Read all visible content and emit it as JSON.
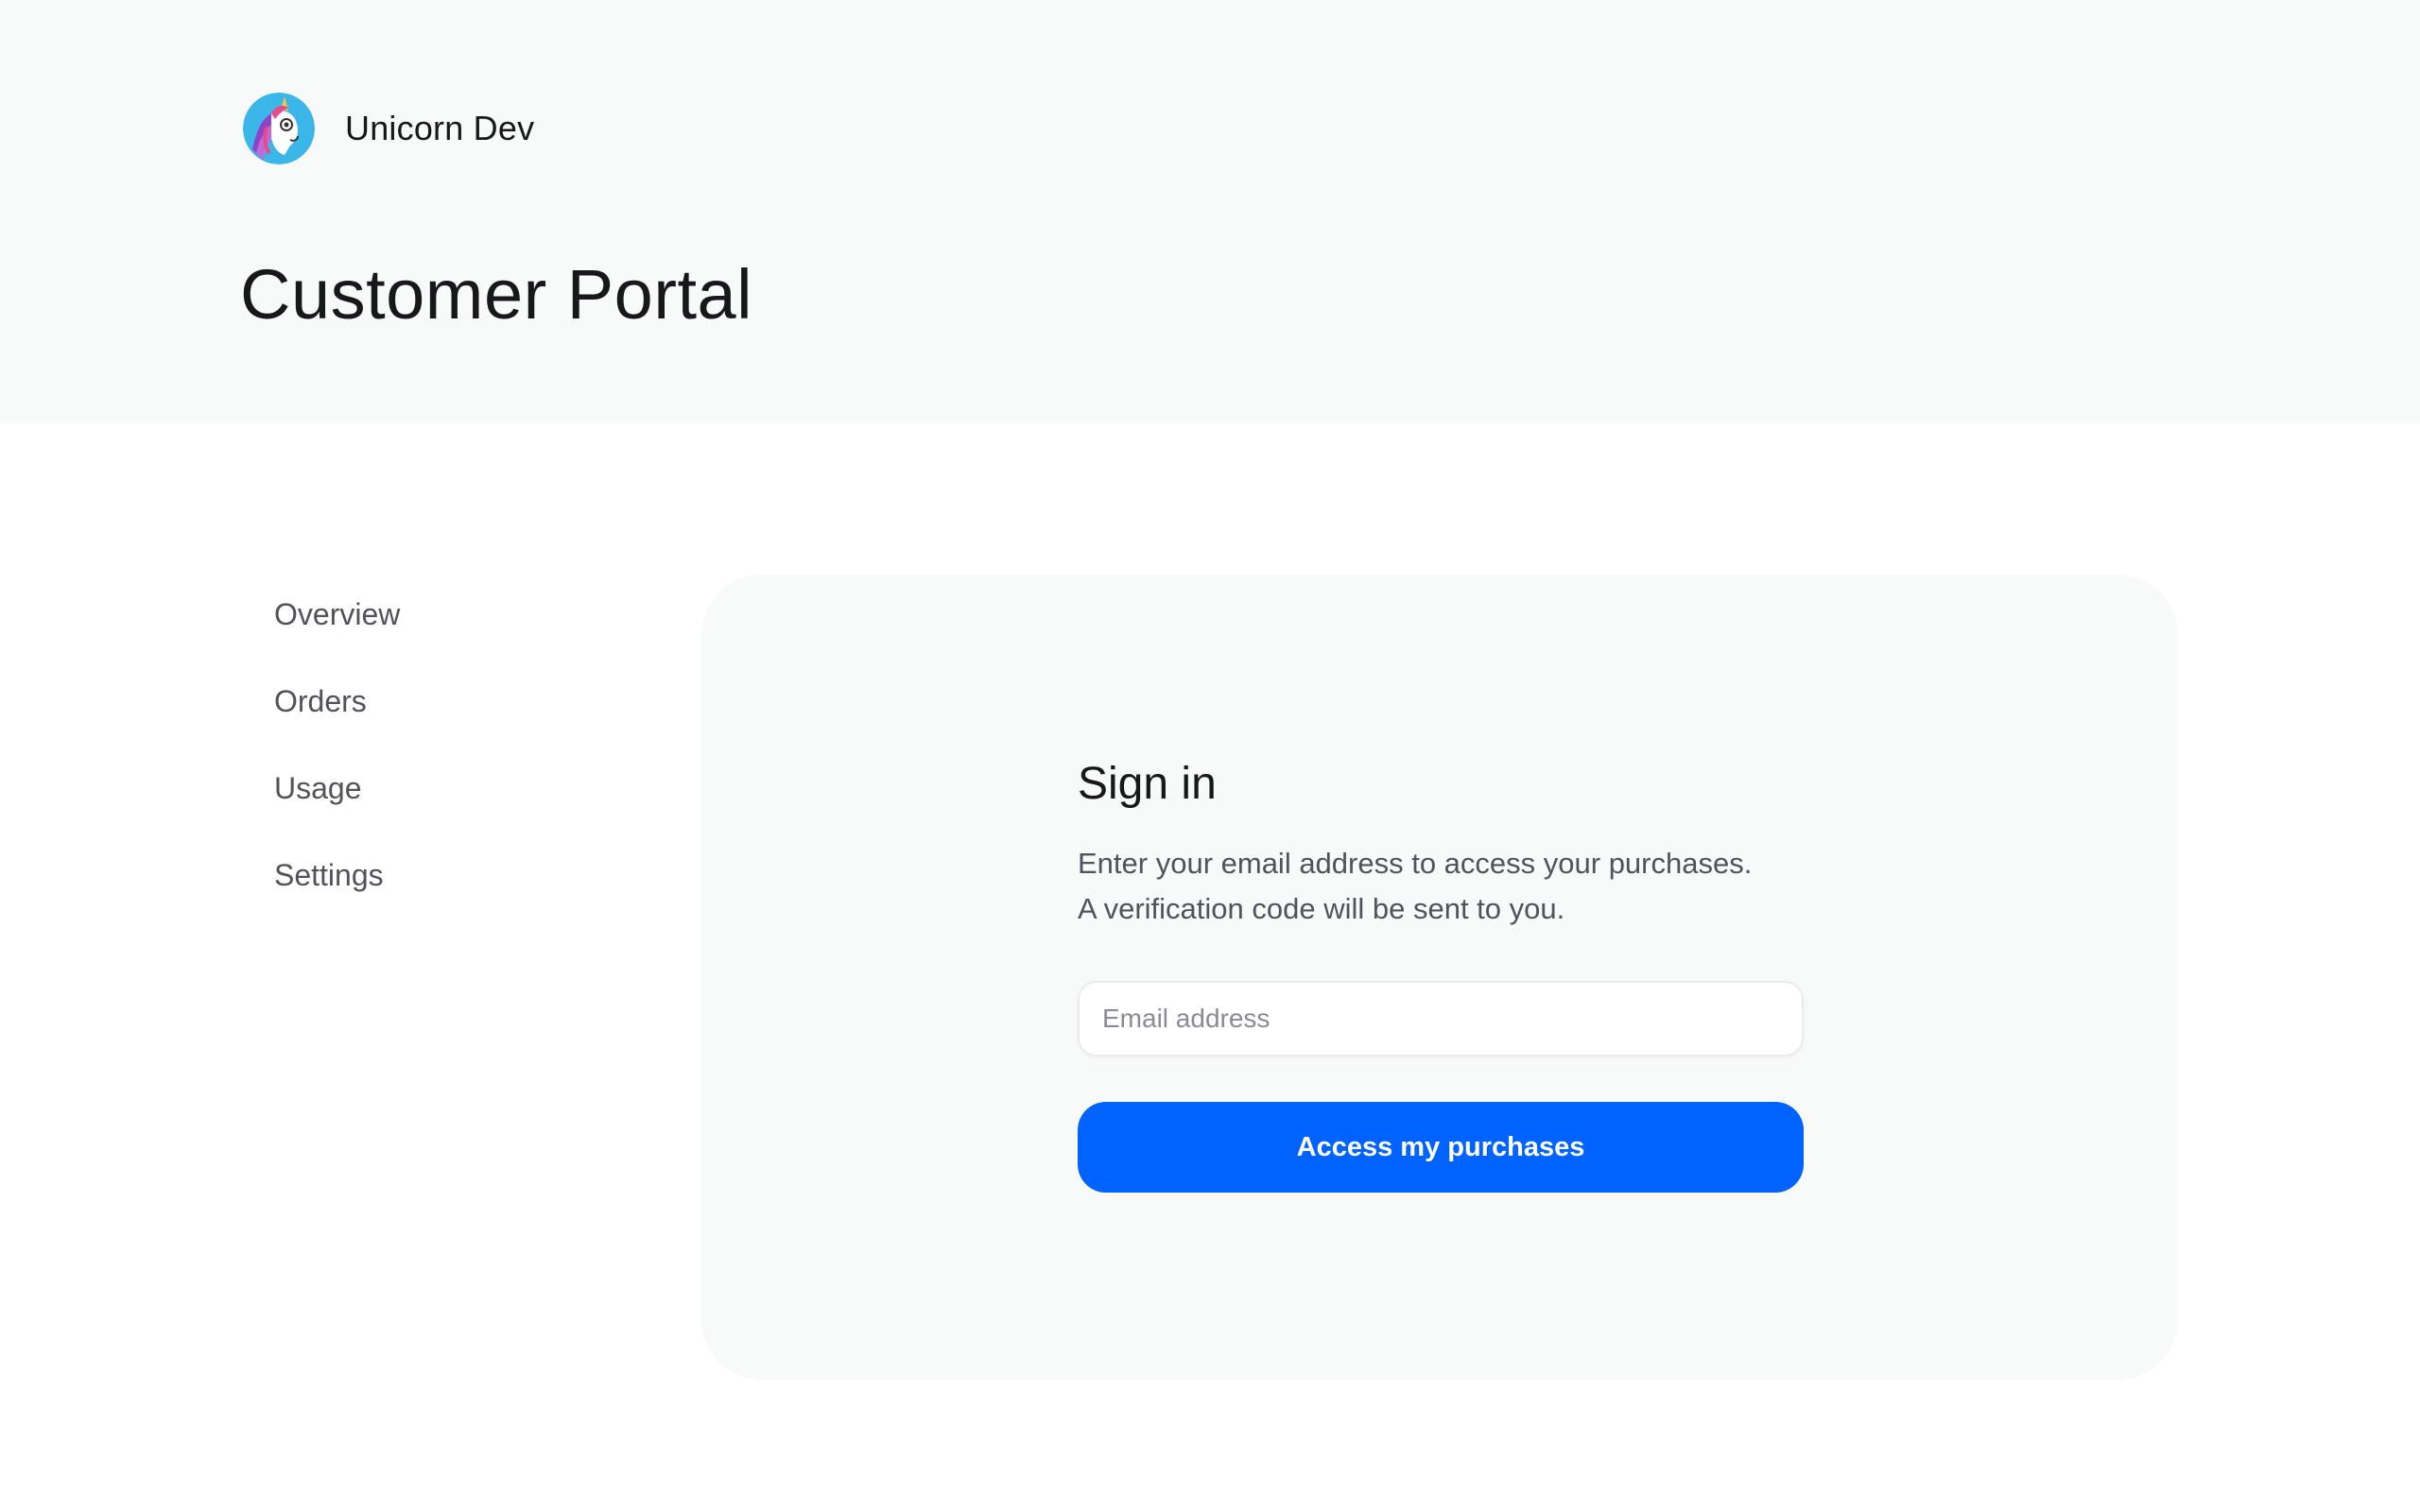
{
  "brand": {
    "name": "Unicorn Dev",
    "logo_icon": "unicorn-avatar-icon"
  },
  "header": {
    "title": "Customer Portal"
  },
  "sidebar": {
    "items": [
      {
        "label": "Overview"
      },
      {
        "label": "Orders"
      },
      {
        "label": "Usage"
      },
      {
        "label": "Settings"
      }
    ]
  },
  "signin": {
    "title": "Sign in",
    "description_line1": "Enter your email address to access your purchases.",
    "description_line2": "A verification code will be sent to you.",
    "email_placeholder": "Email address",
    "email_value": "",
    "submit_label": "Access my purchases"
  },
  "colors": {
    "header_bg": "#f8f9f9",
    "panel_bg": "#f8f9f9",
    "accent": "#0062ff",
    "text_primary": "#18181b",
    "text_secondary": "#52525b"
  }
}
